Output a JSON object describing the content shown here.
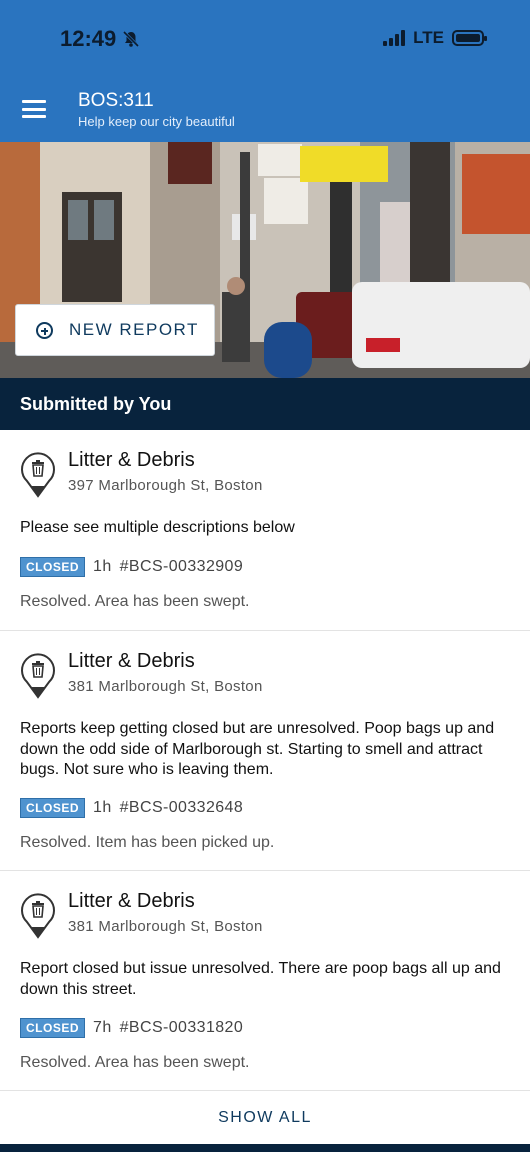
{
  "status_bar": {
    "time": "12:49",
    "network": "LTE"
  },
  "app_bar": {
    "title": "BOS:311",
    "subtitle": "Help keep our city beautiful"
  },
  "hero": {
    "new_report_label": "NEW REPORT"
  },
  "section": {
    "title": "Submitted by You"
  },
  "reports": [
    {
      "category": "Litter & Debris",
      "address": "397 Marlborough St, Boston",
      "description": "Please see multiple descriptions below",
      "status": "CLOSED",
      "age": "1h",
      "case_id": "#BCS-00332909",
      "resolution": "Resolved. Area has been swept."
    },
    {
      "category": "Litter & Debris",
      "address": "381 Marlborough St, Boston",
      "description": "Reports keep getting closed but are unresolved. Poop bags up and down the odd side of Marlborough st. Starting to smell and attract bugs. Not sure who is leaving them.",
      "status": "CLOSED",
      "age": "1h",
      "case_id": "#BCS-00332648",
      "resolution": "Resolved. Item has been picked up."
    },
    {
      "category": "Litter & Debris",
      "address": "381 Marlborough St, Boston",
      "description": "Report closed but issue unresolved. There are poop bags all up and down this street.",
      "status": "CLOSED",
      "age": "7h",
      "case_id": "#BCS-00331820",
      "resolution": "Resolved. Area has been swept."
    }
  ],
  "footer": {
    "show_all_label": "SHOW ALL"
  },
  "colors": {
    "brand_blue": "#2a74bf",
    "navy": "#08233d",
    "badge_blue": "#4f93cf",
    "link_navy": "#0f3a5e"
  },
  "icons": [
    "bell-slash-icon",
    "signal-bars-icon",
    "battery-icon",
    "menu-icon",
    "plus-circle-icon",
    "trash-pin-icon"
  ]
}
